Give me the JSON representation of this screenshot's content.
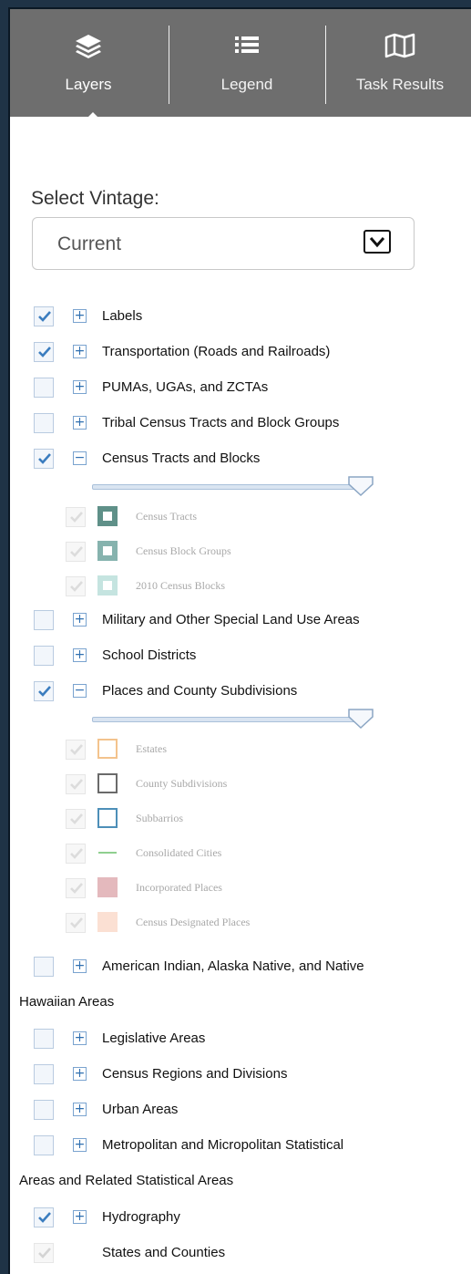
{
  "tabs": [
    {
      "label": "Layers",
      "icon": "layers-icon",
      "active": true
    },
    {
      "label": "Legend",
      "icon": "list-icon",
      "active": false
    },
    {
      "label": "Task Results",
      "icon": "map-icon",
      "active": false
    }
  ],
  "vintage": {
    "label": "Select Vintage:",
    "value": "Current"
  },
  "layers": [
    {
      "label": "Labels",
      "checked": true,
      "expanded": false
    },
    {
      "label": "Transportation (Roads and Railroads)",
      "checked": true,
      "expanded": false
    },
    {
      "label": "PUMAs, UGAs, and ZCTAs",
      "checked": false,
      "expanded": false
    },
    {
      "label": "Tribal Census Tracts and Block Groups",
      "checked": false,
      "expanded": false
    },
    {
      "label": "Census Tracts and Blocks",
      "checked": true,
      "expanded": true,
      "sublayers": [
        {
          "label": "Census Tracts",
          "swatch_fill": "#5f9088",
          "swatch_border": "#5f9088"
        },
        {
          "label": "Census Block Groups",
          "swatch_fill": "#86b3ae",
          "swatch_border": "#86b3ae"
        },
        {
          "label": "2010 Census Blocks",
          "swatch_fill": "#c5e4e0",
          "swatch_border": "#c5e4e0"
        }
      ]
    },
    {
      "label": "Military and Other Special Land Use Areas",
      "checked": false,
      "expanded": false
    },
    {
      "label": "School Districts",
      "checked": false,
      "expanded": false
    },
    {
      "label": "Places and County Subdivisions",
      "checked": true,
      "expanded": true,
      "sublayers": [
        {
          "label": "Estates",
          "swatch_fill": "#ffffff",
          "swatch_border": "#f3c38d"
        },
        {
          "label": "County Subdivisions",
          "swatch_fill": "#ffffff",
          "swatch_border": "#6a6a6a"
        },
        {
          "label": "Subbarrios",
          "swatch_fill": "#ffffff",
          "swatch_border": "#4d8fb8"
        },
        {
          "label": "Consolidated Cities",
          "swatch_fill": "line",
          "swatch_border": "#8fcf8f"
        },
        {
          "label": "Incorporated Places",
          "swatch_fill": "#e4b9bd",
          "swatch_border": "#e4b9bd"
        },
        {
          "label": "Census Designated Places",
          "swatch_fill": "#fbe0d3",
          "swatch_border": "#fbe0d3"
        }
      ]
    },
    {
      "label": "American Indian, Alaska Native, and Native",
      "label2": "Hawaiian Areas",
      "checked": false,
      "expanded": false
    },
    {
      "label": "Legislative Areas",
      "checked": false,
      "expanded": false
    },
    {
      "label": "Census Regions and Divisions",
      "checked": false,
      "expanded": false
    },
    {
      "label": "Urban Areas",
      "checked": false,
      "expanded": false
    },
    {
      "label": "Metropolitan and Micropolitan Statistical",
      "label2": "Areas and Related Statistical Areas",
      "checked": false,
      "expanded": false
    },
    {
      "label": "Hydrography",
      "checked": true,
      "expanded": false
    },
    {
      "label": "States and Counties",
      "checked": true,
      "expanded": false,
      "disabled": true,
      "no_toggle": true
    }
  ],
  "colors": {
    "tabbar": "#6e6e6e",
    "check": "#3b7dbf",
    "frame": "#1f3346"
  }
}
